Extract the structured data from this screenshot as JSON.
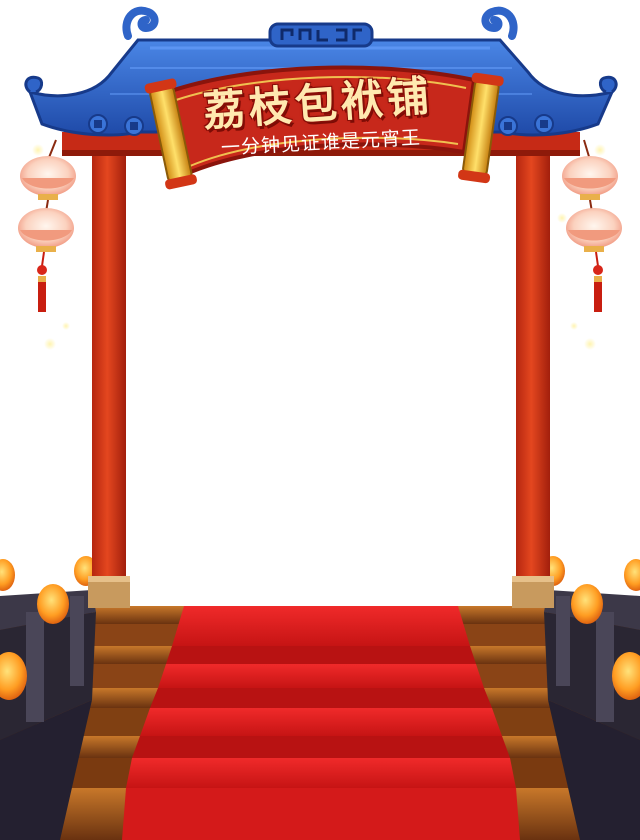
{
  "scene": {
    "signboard": {
      "title": "荔枝包袱铺",
      "subtitle": "一分钟见证谁是元宵王"
    }
  },
  "colors": {
    "roof_tiles": "#2f64c8",
    "roof_edge": "#1e3f9a",
    "pillar": "#d9371b",
    "banner": "#c7281b",
    "scroll_gold": "#f4c12c",
    "carpet": "#e21e1e",
    "stairs": "#a0521c",
    "railing": "#3c3848",
    "lantern": "#ff8a1e",
    "lotus_lantern": "#f7b59a"
  },
  "icons": {
    "hanging_lantern": "lotus-lantern-icon",
    "tassel": "tassel-icon",
    "coin": "coin-icon",
    "post_lantern": "lantern-icon"
  }
}
